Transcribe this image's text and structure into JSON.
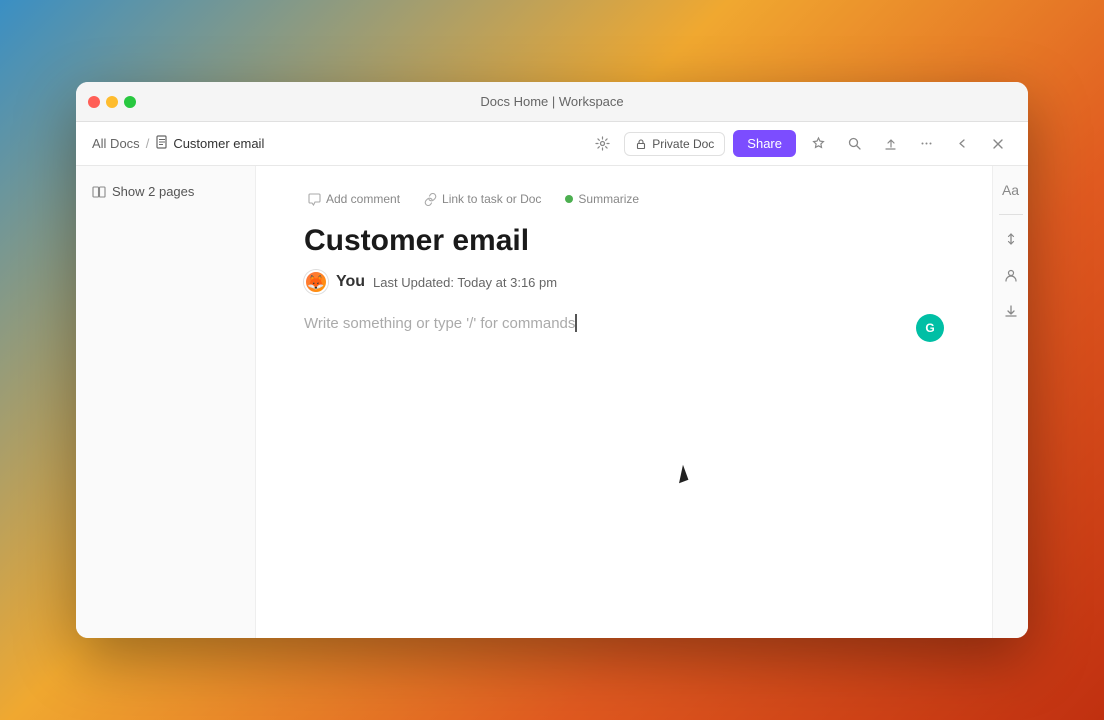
{
  "window": {
    "title": "Docs Home | Workspace"
  },
  "titlebar": {
    "title": "Docs Home | Workspace",
    "traffic_lights": {
      "close": "close",
      "minimize": "minimize",
      "maximize": "maximize"
    }
  },
  "toolbar": {
    "breadcrumb": {
      "parent": "All Docs",
      "separator": "/",
      "current": "Customer email"
    },
    "private_doc_label": "Private Doc",
    "share_label": "Share"
  },
  "sidebar": {
    "show_pages_label": "Show 2 pages"
  },
  "editor_toolbar": {
    "add_comment": "Add comment",
    "link_task": "Link to task or Doc",
    "summarize": "Summarize"
  },
  "editor": {
    "title": "Customer email",
    "author": "You",
    "last_updated": "Last Updated: Today at 3:16 pm",
    "placeholder": "Write something or type '/' for commands"
  },
  "right_sidebar": {
    "font_icon": "Aa",
    "scroll_icon": "↕",
    "people_icon": "👤",
    "download_icon": "↓",
    "settings_icon": "⋯"
  },
  "icons": {
    "comment_icon": "💬",
    "link_icon": "🔗",
    "star_icon": "☆",
    "search_icon": "🔍",
    "export_icon": "↗",
    "more_icon": "···",
    "collapse_icon": "←",
    "close_icon": "✕",
    "lock_icon": "🔒",
    "doc_icon": "📄"
  }
}
